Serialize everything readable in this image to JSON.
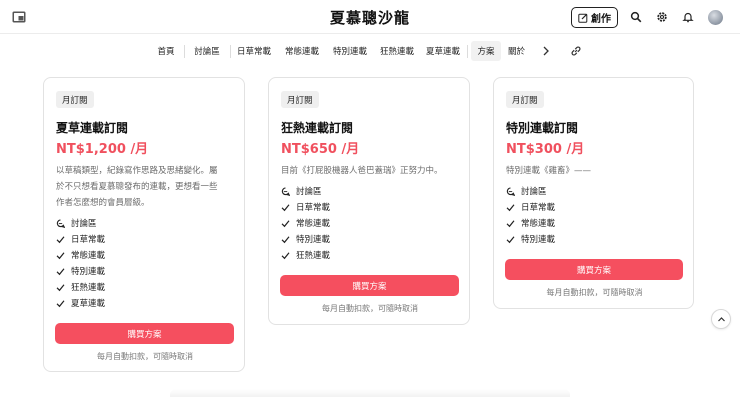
{
  "header": {
    "title": "夏慕聰沙龍",
    "create_label": "創作"
  },
  "nav": {
    "items": [
      "首頁",
      "討論區",
      "日草常載",
      "常態連載",
      "特別連載",
      "狂熱連載",
      "夏草連載",
      "方案",
      "關於"
    ],
    "active": "方案"
  },
  "plans": [
    {
      "badge": "月訂閱",
      "name": "夏草連載訂閱",
      "price": "NT$1,200 /月",
      "description": [
        "以草稿類型，紀錄寫作思路及思緒變化。屬",
        "於不只想看夏慕聰發布的連載，更想看一些",
        "作者怎麼想的會員層級。"
      ],
      "features": [
        "討論區",
        "日草常載",
        "常態連載",
        "特別連載",
        "狂熱連載",
        "夏草連載"
      ],
      "button": "購買方案",
      "note": "每月自動扣款，可隨時取消"
    },
    {
      "badge": "月訂閱",
      "name": "狂熱連載訂閱",
      "price": "NT$650 /月",
      "description": [
        "目前《打屁股機器人爸巴蓋瑞》正努力中。"
      ],
      "features": [
        "討論區",
        "日草常載",
        "常態連載",
        "特別連載",
        "狂熱連載"
      ],
      "button": "購買方案",
      "note": "每月自動扣款，可隨時取消"
    },
    {
      "badge": "月訂閱",
      "name": "特別連載訂閱",
      "price": "NT$300 /月",
      "description": [
        "特別連載《雞畜》——"
      ],
      "features": [
        "討論區",
        "日草常載",
        "常態連載",
        "特別連載"
      ],
      "button": "購買方案",
      "note": "每月自動扣款，可隨時取消"
    }
  ],
  "colors": {
    "accent": "#f54f5f",
    "price": "#f0505e"
  },
  "icons": {
    "header_left": "reader-icon",
    "search": "search-icon",
    "settings": "gear-icon",
    "notifications": "bell-icon",
    "link": "link-icon"
  }
}
